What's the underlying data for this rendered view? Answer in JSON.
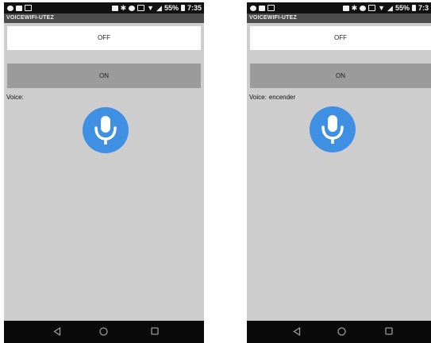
{
  "screens": [
    {
      "status_time": "7:35",
      "battery": "55%",
      "app_title": "VOICEWIFI-UTEZ",
      "off_label": "OFF",
      "on_label": "ON",
      "voice_label": "Voice:",
      "voice_value": ""
    },
    {
      "status_time": "7:3",
      "battery": "55%",
      "app_title": "VOICEWIFI-UTEZ",
      "off_label": "OFF",
      "on_label": "ON",
      "voice_label": "Voice:",
      "voice_value": "encender"
    }
  ],
  "icons": {
    "mic": "microphone-icon",
    "back": "back-triangle-icon",
    "home": "home-circle-icon",
    "recents": "recents-square-icon"
  },
  "colors": {
    "mic_background": "#3f8fe2",
    "app_bar": "#4d4d4d",
    "screen_background": "#cdcdcd",
    "on_button": "#9b9b9b"
  }
}
